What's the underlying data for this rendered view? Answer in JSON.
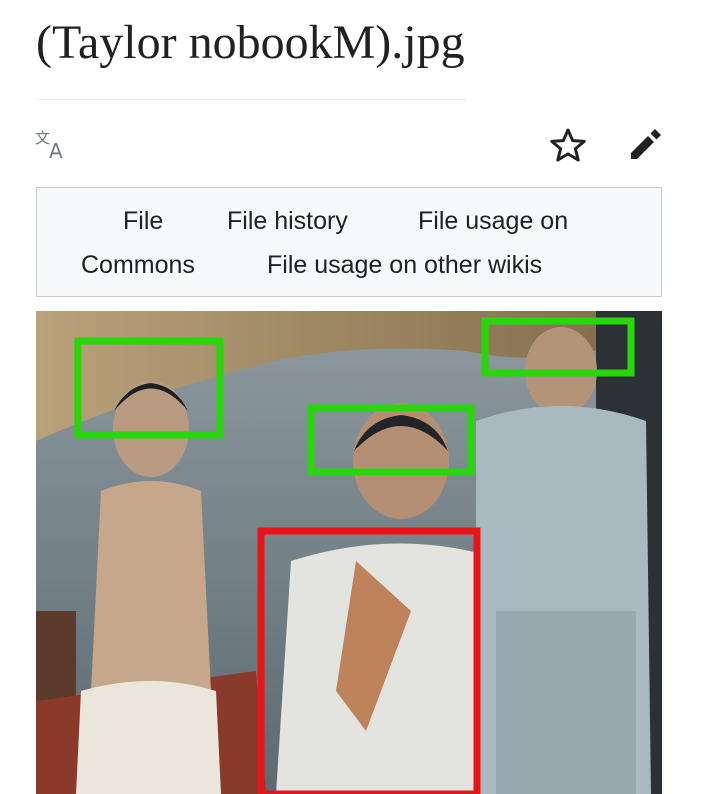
{
  "page": {
    "title": "(Taylor nobookM).jpg"
  },
  "toolbar": {
    "icons": [
      "translate-icon",
      "star-icon",
      "edit-icon"
    ]
  },
  "tabs": [
    {
      "label": "File"
    },
    {
      "label": "File history"
    },
    {
      "label": "File usage on"
    },
    {
      "label": "Commons"
    },
    {
      "label": "File usage on other wikis"
    }
  ],
  "image": {
    "annotations": [
      {
        "kind": "face",
        "color": "#27d60b"
      },
      {
        "kind": "face",
        "color": "#27d60b"
      },
      {
        "kind": "face",
        "color": "#27d60b"
      },
      {
        "kind": "figure",
        "color": "#e8141a"
      }
    ]
  },
  "colors": {
    "text": "#202122",
    "border": "#c8ccd1",
    "annotation_green": "#27d60b",
    "annotation_red": "#e8141a"
  }
}
